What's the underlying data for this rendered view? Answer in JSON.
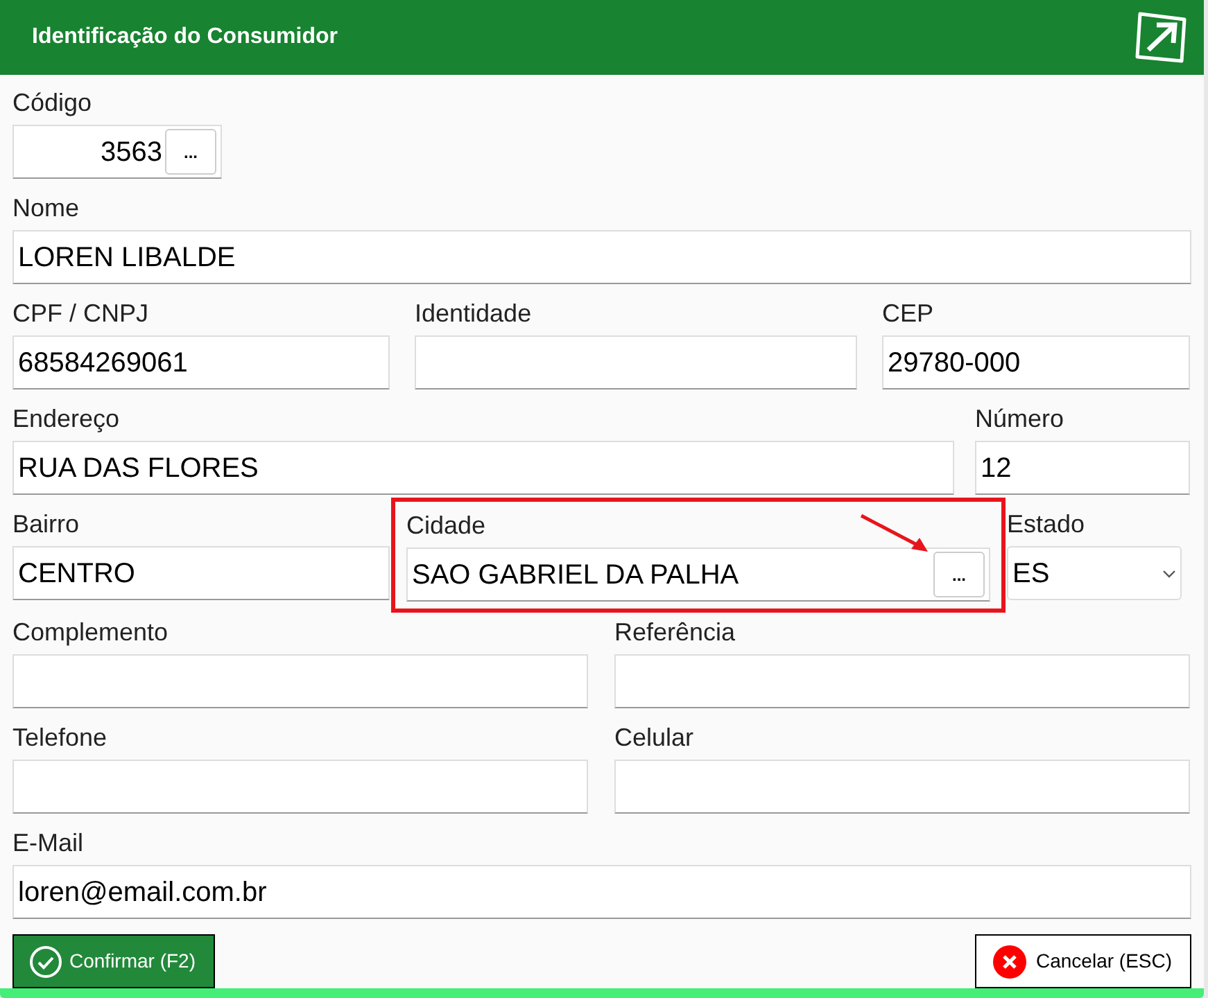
{
  "window": {
    "title": "Identificação do Consumidor"
  },
  "rows": [
    {
      "fields": [
        {
          "label": "Código",
          "value": "3563",
          "kind": "code",
          "highlighted": false,
          "button": "..."
        }
      ]
    },
    {
      "fields": [
        {
          "label": "Nome",
          "value": "LOREN LIBALDE",
          "kind": "text",
          "highlighted": false
        }
      ]
    },
    {
      "fields": [
        {
          "label": "CPF / CNPJ",
          "value": "68584269061",
          "kind": "text",
          "highlighted": false
        },
        {
          "label": "Identidade",
          "kind": "text",
          "highlighted": false
        },
        {
          "label": "CEP",
          "value": "29780-000",
          "kind": "text",
          "highlighted": false
        }
      ]
    },
    {
      "fields": [
        {
          "label": "Endereço",
          "value": "RUA DAS FLORES",
          "kind": "text",
          "highlighted": false
        },
        {
          "label": "Número",
          "value": "12",
          "kind": "text",
          "highlighted": false
        }
      ]
    },
    {
      "fields": [
        {
          "label": "Bairro",
          "value": "CENTRO",
          "kind": "text",
          "highlighted": false
        },
        {
          "label": "Cidade",
          "value": "SAO GABRIEL DA PALHA",
          "kind": "lookup",
          "highlighted": true,
          "button": "..."
        },
        {
          "label": "Estado",
          "value": "ES",
          "kind": "select",
          "highlighted": false
        }
      ]
    },
    {
      "fields": [
        {
          "label": "Complemento",
          "kind": "text",
          "highlighted": false
        },
        {
          "label": "Referência",
          "kind": "text",
          "highlighted": false
        }
      ]
    },
    {
      "fields": [
        {
          "label": "Telefone",
          "kind": "text",
          "highlighted": false
        },
        {
          "label": "Celular",
          "kind": "text",
          "highlighted": false
        }
      ]
    },
    {
      "fields": [
        {
          "label": "E-Mail",
          "value": "loren@email.com.br",
          "kind": "text",
          "highlighted": false
        }
      ]
    }
  ],
  "buttons": [
    {
      "label": "Confirmar (F2)",
      "kind": "confirm"
    },
    {
      "label": "Cancelar (ESC)",
      "kind": "cancel"
    }
  ]
}
